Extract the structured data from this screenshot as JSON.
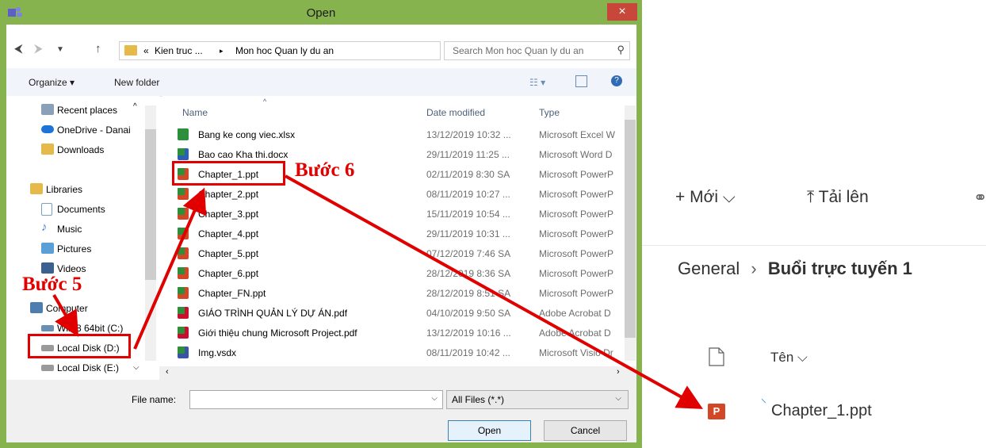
{
  "dialog": {
    "title": "Open",
    "close": "×",
    "address": {
      "crumbs": [
        "«",
        "Kien truc ...",
        "▸",
        "Mon hoc Quan ly du an"
      ],
      "search_placeholder": "Search Mon hoc Quan ly du an"
    },
    "toolbar": {
      "organize": "Organize ▾",
      "new_folder": "New folder"
    },
    "nav_items": [
      {
        "label": "Recent places",
        "color": "#8a9fb8"
      },
      {
        "label": "OneDrive - Danai",
        "color": "#1e73d8"
      },
      {
        "label": "Downloads",
        "color": "#e5b94a"
      },
      {
        "label": "Libraries",
        "color": "#e5b94a"
      },
      {
        "label": "Documents",
        "color": "#7d9ebf"
      },
      {
        "label": "Music",
        "color": "#3a7fd5"
      },
      {
        "label": "Pictures",
        "color": "#5a9fd5"
      },
      {
        "label": "Videos",
        "color": "#3b5f8f"
      },
      {
        "label": "Computer",
        "color": "#4e7db0"
      },
      {
        "label": "Win 8 64bit (C:)",
        "color": "#6b8fb0"
      },
      {
        "label": "Local Disk (D:)",
        "color": "#9a9a9a"
      },
      {
        "label": "Local Disk (E:)",
        "color": "#9a9a9a"
      }
    ],
    "columns": {
      "name": "Name",
      "date": "Date modified",
      "type": "Type"
    },
    "files": [
      {
        "name": "Bang ke cong viec.xlsx",
        "date": "13/12/2019 10:32 ...",
        "type": "Microsoft Excel W",
        "color": "#2d8f3a"
      },
      {
        "name": "Bao cao Kha thi.docx",
        "date": "29/11/2019 11:25 ...",
        "type": "Microsoft Word D",
        "color": "#2b5fb4"
      },
      {
        "name": "Chapter_1.ppt",
        "date": "02/11/2019 8:30 SA",
        "type": "Microsoft PowerP",
        "color": "#d24726"
      },
      {
        "name": "Chapter_2.ppt",
        "date": "08/11/2019 10:27 ...",
        "type": "Microsoft PowerP",
        "color": "#d24726"
      },
      {
        "name": "Chapter_3.ppt",
        "date": "15/11/2019 10:54 ...",
        "type": "Microsoft PowerP",
        "color": "#d24726"
      },
      {
        "name": "Chapter_4.ppt",
        "date": "29/11/2019 10:31 ...",
        "type": "Microsoft PowerP",
        "color": "#d24726"
      },
      {
        "name": "Chapter_5.ppt",
        "date": "07/12/2019 7:46 SA",
        "type": "Microsoft PowerP",
        "color": "#d24726"
      },
      {
        "name": "Chapter_6.ppt",
        "date": "28/12/2019 8:36 SA",
        "type": "Microsoft PowerP",
        "color": "#d24726"
      },
      {
        "name": "Chapter_FN.ppt",
        "date": "28/12/2019 8:51 SA",
        "type": "Microsoft PowerP",
        "color": "#d24726"
      },
      {
        "name": "GIÁO TRÌNH QUẢN LÝ DỰ ÁN.pdf",
        "date": "04/10/2019 9:50 SA",
        "type": "Adobe Acrobat D",
        "color": "#c8102e"
      },
      {
        "name": "Giới thiệu chung Microsoft Project.pdf",
        "date": "13/12/2019 10:16 ...",
        "type": "Adobe Acrobat D",
        "color": "#c8102e"
      },
      {
        "name": "Img.vsdx",
        "date": "08/11/2019 10:42 ...",
        "type": "Microsoft Visio Dr",
        "color": "#3955a3"
      }
    ],
    "bottom": {
      "file_name_label": "File name:",
      "file_name_value": "",
      "filter": "All Files (*.*)",
      "open": "Open",
      "cancel": "Cancel"
    }
  },
  "annotations": {
    "step5": "Bước 5",
    "step6": "Bước 6"
  },
  "sharepoint": {
    "new": "+ Mới ⌵",
    "upload": "⤒ Tải lên",
    "breadcrumb_root": "General",
    "breadcrumb_sep": "›",
    "breadcrumb_current": "Buổi trực tuyến 1",
    "name_header": "Tên ⌵",
    "file_name": "Chapter_1.ppt",
    "file_icon_letter": "P"
  },
  "colors": {
    "accent_green": "#86b34d",
    "annotation_red": "#e00000",
    "ppt_red": "#d24726"
  }
}
